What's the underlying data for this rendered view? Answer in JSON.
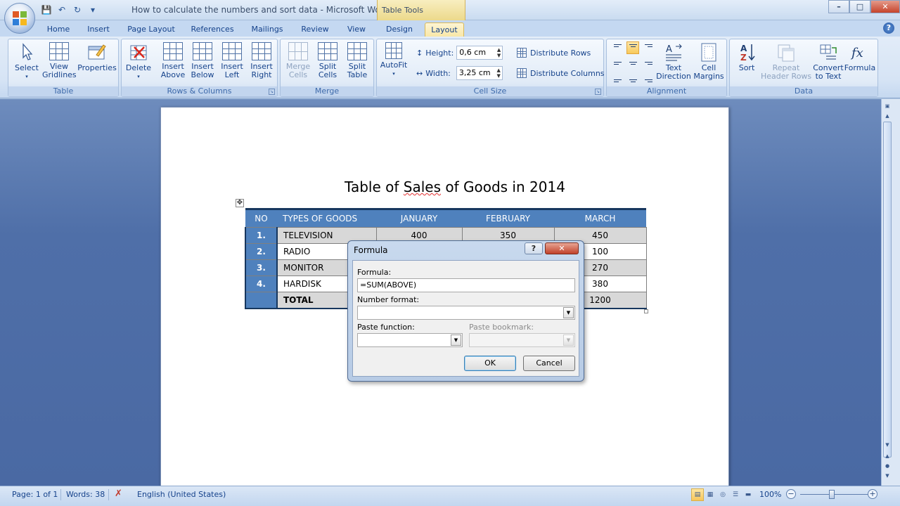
{
  "window": {
    "title": "How to calculate the numbers and sort data - Microsoft Wo...",
    "context_tab": "Table Tools",
    "controls": [
      "–",
      "□",
      "✕"
    ]
  },
  "tabs": [
    {
      "label": "Home"
    },
    {
      "label": "Insert"
    },
    {
      "label": "Page Layout"
    },
    {
      "label": "References"
    },
    {
      "label": "Mailings"
    },
    {
      "label": "Review"
    },
    {
      "label": "View"
    },
    {
      "label": "Design"
    },
    {
      "label": "Layout"
    }
  ],
  "ribbon": {
    "table": {
      "label": "Table",
      "select": "Select",
      "view_gridlines": [
        "View",
        "Gridlines"
      ],
      "properties": "Properties"
    },
    "rows_columns": {
      "label": "Rows & Columns",
      "delete": "Delete",
      "insert_above": [
        "Insert",
        "Above"
      ],
      "insert_below": [
        "Insert",
        "Below"
      ],
      "insert_left": [
        "Insert",
        "Left"
      ],
      "insert_right": [
        "Insert",
        "Right"
      ]
    },
    "merge": {
      "label": "Merge",
      "merge_cells": [
        "Merge",
        "Cells"
      ],
      "split_cells": [
        "Split",
        "Cells"
      ],
      "split_table": [
        "Split",
        "Table"
      ]
    },
    "cell_size": {
      "label": "Cell Size",
      "autofit": "AutoFit",
      "height_label": "Height:",
      "height_value": "0,6 cm",
      "width_label": "Width:",
      "width_value": "3,25 cm",
      "distribute_rows": "Distribute Rows",
      "distribute_columns": "Distribute Columns"
    },
    "alignment": {
      "label": "Alignment",
      "text_direction": [
        "Text",
        "Direction"
      ],
      "cell_margins": [
        "Cell",
        "Margins"
      ]
    },
    "data": {
      "label": "Data",
      "sort": "Sort",
      "repeat_header_rows": [
        "Repeat",
        "Header Rows"
      ],
      "convert_to_text": [
        "Convert",
        "to Text"
      ],
      "formula": "Formula"
    }
  },
  "document": {
    "title_prefix": "Table of ",
    "title_squiggle": "Sales",
    "title_suffix": " of Goods in 2014",
    "headers": [
      "NO",
      "TYPES OF GOODS",
      "JANUARY",
      "FEBRUARY",
      "MARCH"
    ],
    "rows": [
      {
        "no": "1.",
        "item": "TELEVISION",
        "jan": "400",
        "feb": "350",
        "mar": "450"
      },
      {
        "no": "2.",
        "item": "RADIO",
        "jan": "",
        "feb": "",
        "mar": "100"
      },
      {
        "no": "3.",
        "item": "MONITOR",
        "jan": "",
        "feb": "",
        "mar": "270"
      },
      {
        "no": "4.",
        "item": "HARDISK",
        "jan": "",
        "feb": "",
        "mar": "380"
      }
    ],
    "total": {
      "label": "TOTAL",
      "mar": "1200"
    }
  },
  "dialog": {
    "title": "Formula",
    "help": "?",
    "close": "✕",
    "formula_label": "Formula:",
    "formula_value": "=SUM(ABOVE)",
    "number_format_label": "Number format:",
    "number_format_value": "",
    "paste_function_label": "Paste function:",
    "paste_bookmark_label": "Paste bookmark:",
    "ok": "OK",
    "cancel": "Cancel"
  },
  "status": {
    "page": "Page: 1 of 1",
    "words": "Words: 38",
    "language": "English (United States)",
    "zoom": "100%"
  },
  "colors": {
    "header_fill": "#4f81bd",
    "header_border": "#17375e",
    "context_tab": "#ecd98b"
  }
}
